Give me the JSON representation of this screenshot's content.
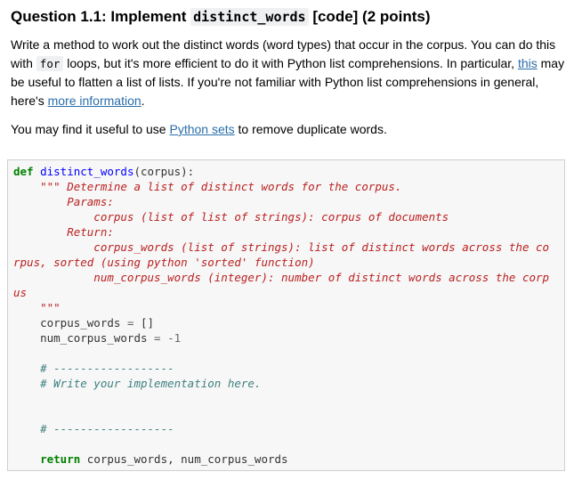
{
  "heading": {
    "prefix": "Question 1.1: Implement ",
    "code": "distinct_words",
    "suffix": " [code] (2 points)"
  },
  "para1": {
    "t1": "Write a method to work out the distinct words (word types) that occur in the corpus. You can do this with ",
    "code": "for",
    "t2": " loops, but it's more efficient to do it with Python list comprehensions. In particular, ",
    "link1": "this",
    "t3": " may be useful to flatten a list of lists. If you're not familiar with Python list comprehensions in general, here's ",
    "link2": "more information",
    "t4": "."
  },
  "para2": {
    "t1": "You may find it useful to use ",
    "link": "Python sets",
    "t2": " to remove duplicate words."
  },
  "code": {
    "kw_def": "def",
    "func_name": "distinct_words",
    "sig_rest": "(corpus):",
    "doc1": "    \"\"\" Determine a list of distinct words for the corpus.",
    "doc2": "        Params:",
    "doc3": "            corpus (list of list of strings): corpus of documents",
    "doc4": "        Return:",
    "doc5": "            corpus_words (list of strings): list of distinct words across the co",
    "doc6": "rpus, sorted (using python 'sorted' function)",
    "doc7": "            num_corpus_words (integer): number of distinct words across the corp",
    "doc8": "us",
    "doc9": "    \"\"\"",
    "l1_var": "    corpus_words ",
    "l1_op": "=",
    "l1_val": " []",
    "l2_var": "    num_corpus_words ",
    "l2_op": "=",
    "l2_sp": " ",
    "l2_val": "-1",
    "cm1": "    # ------------------",
    "cm2": "    # Write your implementation here.",
    "cm3": "    # ------------------",
    "ret_indent": "    ",
    "kw_return": "return",
    "ret_rest": " corpus_words, num_corpus_words"
  }
}
